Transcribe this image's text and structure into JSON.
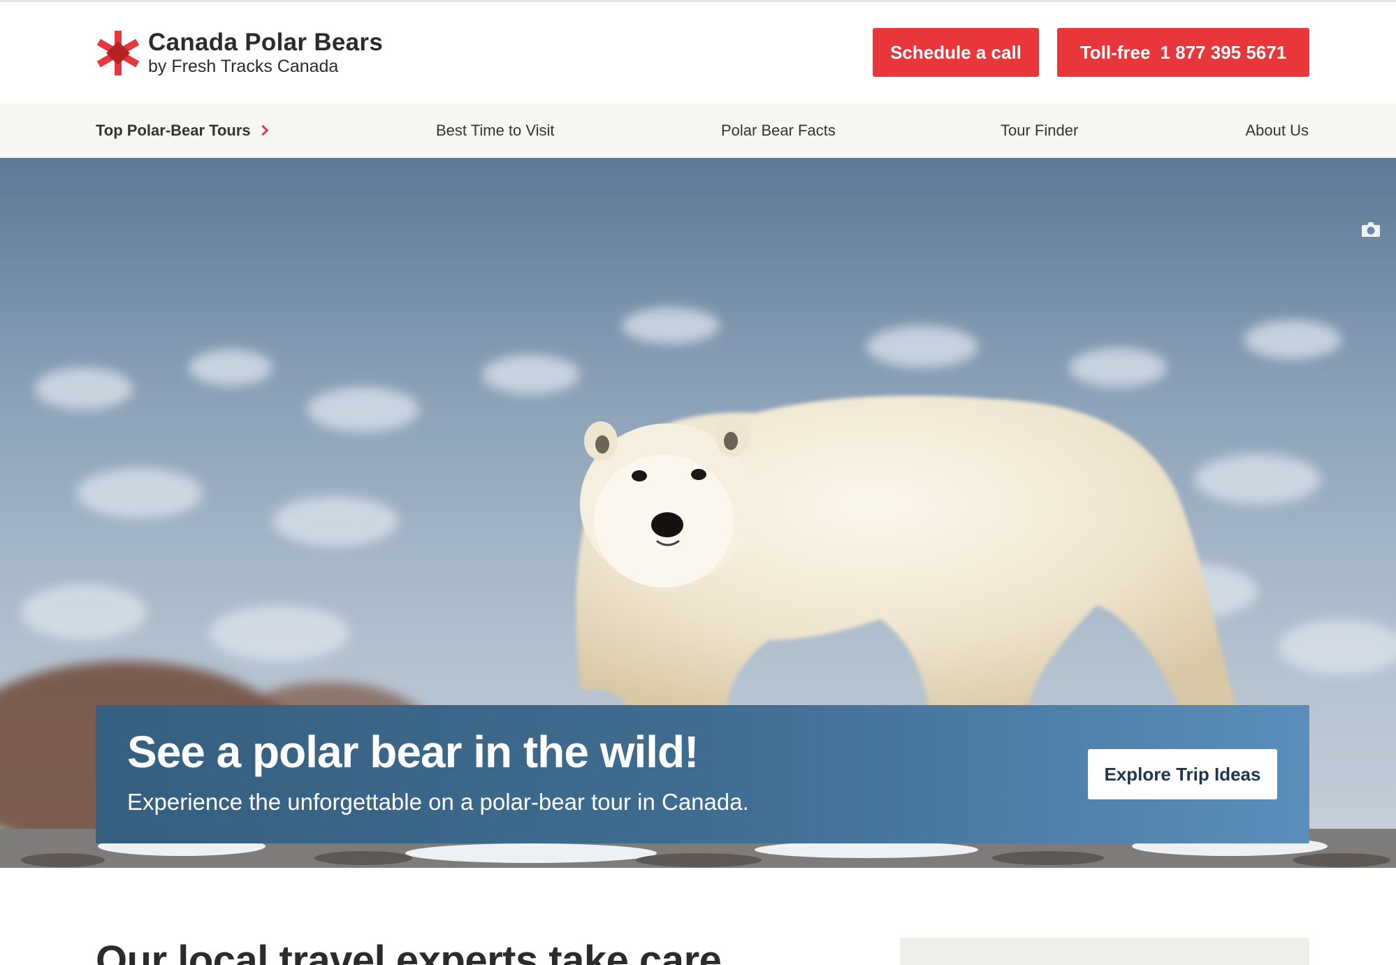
{
  "brand": {
    "title": "Canada Polar Bears",
    "subtitle": "by Fresh Tracks Canada",
    "accent": "#e8363b",
    "logo_icon": "maple-star-icon"
  },
  "header": {
    "schedule_label": "Schedule a call",
    "tollfree_label": "Toll-free",
    "tollfree_number": "1 877 395 5671"
  },
  "nav": {
    "items": [
      {
        "label": "Top Polar-Bear Tours",
        "icon": "chevron-right-icon"
      },
      {
        "label": "Best Time to Visit"
      },
      {
        "label": "Polar Bear Facts"
      },
      {
        "label": "Tour Finder"
      },
      {
        "label": "About Us"
      }
    ]
  },
  "hero": {
    "title": "See a polar bear in the wild!",
    "subtitle": "Experience the unforgettable on a polar-bear tour in Canada.",
    "cta_label": "Explore Trip Ideas",
    "photo_icon": "camera-icon",
    "panel_color": "#3f6c90"
  },
  "section": {
    "heading": "Our local travel experts take care"
  }
}
